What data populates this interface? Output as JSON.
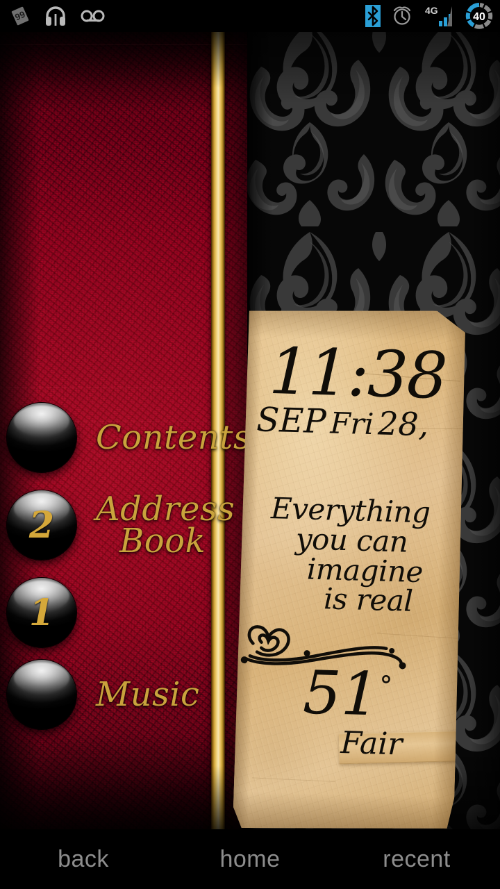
{
  "statusbar": {
    "left_icons": [
      {
        "name": "app-notification-icon",
        "glyph": "▧"
      },
      {
        "name": "headphones-icon",
        "glyph": "♫"
      },
      {
        "name": "voicemail-icon",
        "glyph": "∞"
      }
    ],
    "right_icons": [
      {
        "name": "bluetooth-icon",
        "color": "#2a9fd6"
      },
      {
        "name": "alarm-clock-icon",
        "color": "#9a9a9a"
      },
      {
        "name": "network-4g-icon",
        "label": "4G",
        "color": "#2a9fd6"
      },
      {
        "name": "battery-icon",
        "level": "40",
        "color": "#2a9fd6"
      }
    ]
  },
  "shortcuts": {
    "items": [
      {
        "label": "Contents",
        "badge": "",
        "lines": [
          "Contents"
        ]
      },
      {
        "label": "Address Book",
        "badge": "2",
        "lines": [
          "Address",
          "Book"
        ]
      },
      {
        "label": "",
        "badge": "1",
        "lines": []
      },
      {
        "label": "Music",
        "badge": "",
        "lines": [
          "Music"
        ]
      }
    ]
  },
  "note": {
    "clock": "11:38",
    "date_month": "SEP",
    "date_weekday": "Fri",
    "date_day": "28,",
    "quote_lines": [
      "Everything",
      "you can",
      "imagine",
      "is real"
    ],
    "temperature": "51",
    "degree_symbol": "°",
    "condition": "Fair"
  },
  "navbar": {
    "buttons": [
      {
        "name": "back",
        "label": "back"
      },
      {
        "name": "home",
        "label": "home"
      },
      {
        "name": "recent",
        "label": "recent"
      }
    ]
  },
  "colors": {
    "red_panel": "#8d0020",
    "gold_accent": "#c9a33c",
    "paper": "#e3c293",
    "ink": "#100d08",
    "nav_text": "#8d8d8d",
    "bluetooth_blue": "#2a9fd6"
  }
}
